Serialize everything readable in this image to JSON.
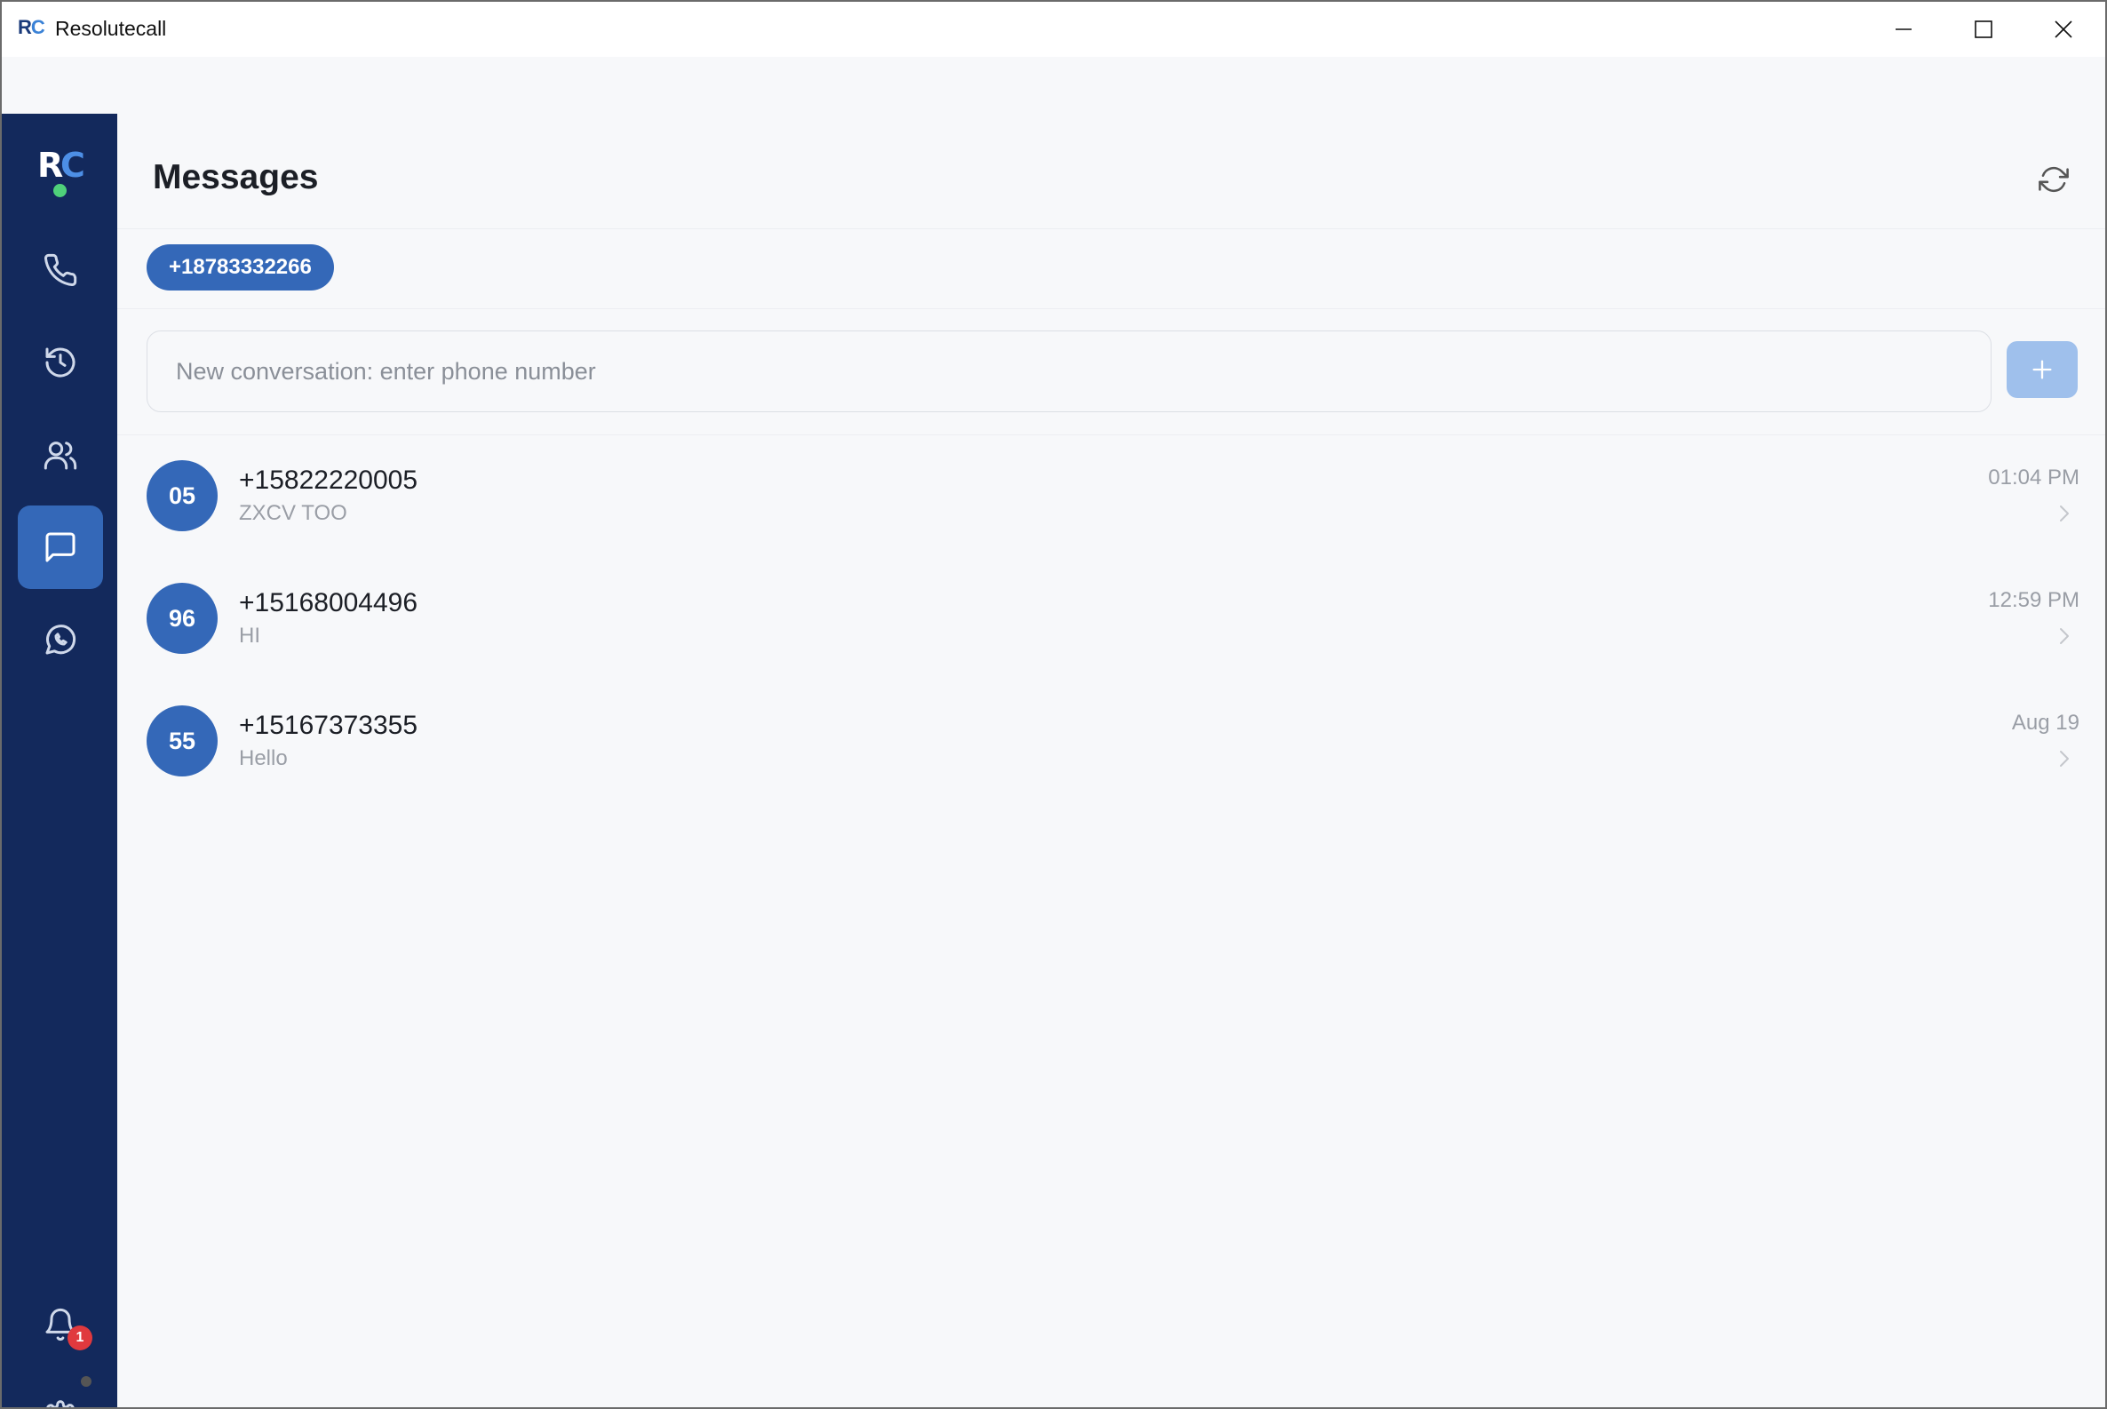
{
  "window": {
    "logo_r": "R",
    "logo_c": "C",
    "title": "Resolutecall",
    "controls": [
      "minimize-icon",
      "maximize-icon",
      "close-icon"
    ]
  },
  "sidebar": {
    "logo": {
      "r": "R",
      "c": "C",
      "status": "online"
    },
    "items": [
      {
        "id": "calls",
        "icon": "phone-icon",
        "active": false
      },
      {
        "id": "history",
        "icon": "history-icon",
        "active": false
      },
      {
        "id": "contacts",
        "icon": "contacts-icon",
        "active": false
      },
      {
        "id": "messages",
        "icon": "message-icon",
        "active": true
      },
      {
        "id": "whatsapp",
        "icon": "whatsapp-icon",
        "active": false
      }
    ],
    "notifications": {
      "icon": "bell-icon",
      "count": "1"
    },
    "settings": {
      "icon": "gear-icon"
    }
  },
  "main": {
    "title": "Messages",
    "phone_number": "+18783332266",
    "new_conversation": {
      "placeholder": "New conversation: enter phone number",
      "value": ""
    },
    "conversations": [
      {
        "initials": "05",
        "number": "+15822220005",
        "preview": "ZXCV TOO",
        "time": "01:04 PM"
      },
      {
        "initials": "96",
        "number": "+15168004496",
        "preview": "HI",
        "time": "12:59 PM"
      },
      {
        "initials": "55",
        "number": "+15167373355",
        "preview": "Hello",
        "time": "Aug 19"
      }
    ]
  },
  "colors": {
    "sidebar_bg": "#13295c",
    "accent": "#3468b8",
    "add_button": "#9fc0ec",
    "badge": "#e0393e",
    "status_online": "#4fd17a"
  }
}
